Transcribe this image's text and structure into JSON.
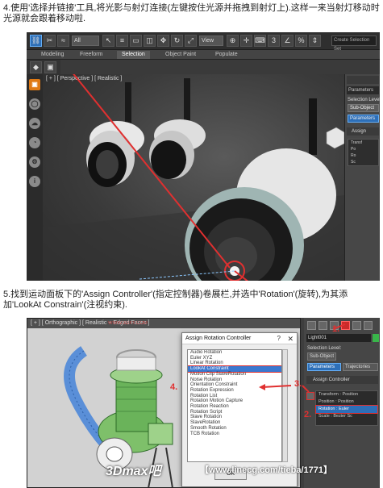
{
  "step4_text": "4.使用'选择并链接'工具,将光影与射灯连接(左键按住光源并拖拽到射灯上).这样一来当射灯移动时光源就会跟着移动啦.",
  "step5_text": "5.找到运动面板下的'Assign Controller'(指定控制器)卷展栏,并选中'Rotation'(旋转),为其添加'LookAt Constrain'(注视约束).",
  "shot1": {
    "filter_select": "All",
    "view_select": "View",
    "search_placeholder": "Create Selection Set",
    "ribbon_tabs": [
      "Modeling",
      "Freeform",
      "Selection",
      "Object Paint",
      "Populate"
    ],
    "active_ribbon_tab": "Selection",
    "viewport_label": "[ + ] [ Perspective ] [ Realistic ]",
    "cmd_panel": {
      "param_label": "Parameters",
      "selection_level": "Selection Level:",
      "sub_object": "Sub-Object",
      "param_button": "Parameters",
      "assign_section": "Assign",
      "list_items": [
        "Transf",
        "Po",
        "Ro",
        "Sc"
      ]
    },
    "left_icons": [
      "cube-icon",
      "sphere-icon",
      "cloud-icon",
      "history-icon",
      "gear-icon",
      "info-icon"
    ]
  },
  "shot2": {
    "viewport_label": "[ + ] [ Orthographic ] [ Realistic + Edged Faces ]",
    "watermark": "WWW.3DXY.COM",
    "dialog": {
      "title": "Assign Rotation Controller",
      "help": "?",
      "close": "✕",
      "items": [
        "Audio Rotation",
        "Euler XYZ",
        "Linear Rotation",
        "LookAt Constraint",
        "Motion Clip SlaveRotation",
        "Noise Rotation",
        "Orientation Constraint",
        "Rotation Expression",
        "Rotation List",
        "Rotation Motion Capture",
        "Rotation Reaction",
        "Rotation Script",
        "Slave Rotation",
        "SlaveRotation",
        "Smooth Rotation",
        "TCB Rotation"
      ],
      "selected_index": 3,
      "ok_label": "OK"
    },
    "cmd_panel": {
      "object_name": "Light001",
      "swatch_color": "#39b54a",
      "selection_level": "Selection Level:",
      "sub_object": "Sub-Object",
      "tab_parameters": "Parameters",
      "tab_trajectories": "Trajectories",
      "assign_section": "Assign Controller",
      "tree_rows": [
        "Transform : Position",
        "Position : Position",
        "Rotation : Euler",
        "Scale : Bezier Sc"
      ],
      "selected_row": 2
    },
    "step_numbers": [
      "1.",
      "2.",
      "3.",
      "4."
    ]
  },
  "footer": {
    "logo_text": "3Dmax吧",
    "url": "【www.linecg.com/tieba/1771】"
  },
  "colors": {
    "annotation_red": "#e03030",
    "highlight_blue": "#2d6fb8",
    "max_dark": "#3a3a3a"
  }
}
